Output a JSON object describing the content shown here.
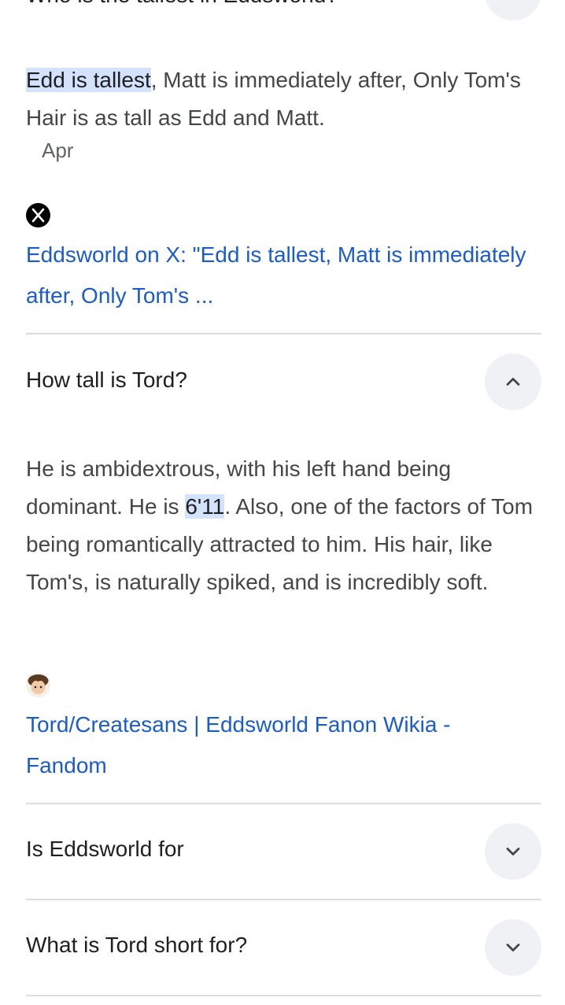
{
  "faq0": {
    "question": "Who is the tallest in Eddsworld?",
    "answer_highlight": "Edd is tallest",
    "answer_rest": ", Matt is immediately after, Only Tom's Hair is as tall as Edd and Matt.",
    "date": "Apr",
    "source_icon": "x-logo-icon",
    "source_title": "Eddsworld on X: \"Edd is tallest, Matt is immediately after, Only Tom's ..."
  },
  "faq1": {
    "question": "How tall is Tord?",
    "toggle_icon": "chevron-up-icon",
    "answer_part1": "He is ambidextrous, with his left hand being dominant. He is ",
    "answer_highlight": "6'11",
    "answer_part2": ". Also, one of the factors of Tom being romantically attracted to him. His hair, like Tom's, is naturally spiked, and is incredibly soft.",
    "source_icon": "fandom-avatar-icon",
    "source_title": "Tord/Createsans | Eddsworld Fanon Wikia - Fandom"
  },
  "faq2": {
    "question": "Is Eddsworld for",
    "toggle_icon": "chevron-down-icon"
  },
  "faq3": {
    "question": "What is Tord short for?",
    "toggle_icon": "chevron-down-icon"
  },
  "colors": {
    "link": "#1a5ccf",
    "highlight": "#d3e3fd",
    "button_bg": "#f0f1f4"
  }
}
